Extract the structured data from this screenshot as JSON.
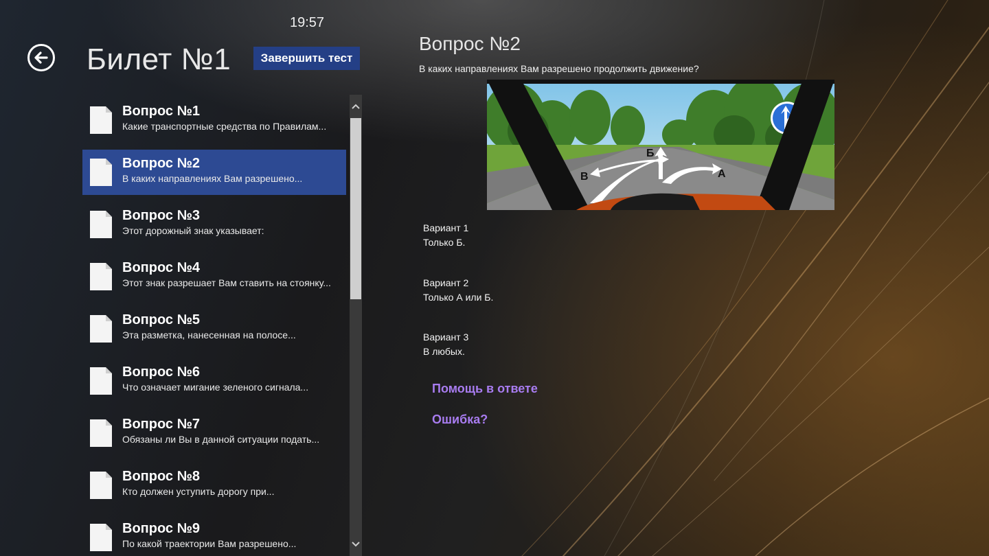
{
  "status": {
    "time": "19:57"
  },
  "header": {
    "title": "Билет №1",
    "finish_label": "Завершить тест"
  },
  "questions": [
    {
      "title": "Вопрос №1",
      "preview": "Какие транспортные средства по Правилам..."
    },
    {
      "title": "Вопрос №2",
      "preview": "В каких направлениях Вам разрешено..."
    },
    {
      "title": "Вопрос №3",
      "preview": "Этот дорожный знак указывает:"
    },
    {
      "title": "Вопрос №4",
      "preview": "Этот знак разрешает Вам ставить на стоянку..."
    },
    {
      "title": "Вопрос №5",
      "preview": "Эта разметка, нанесенная на полосе..."
    },
    {
      "title": "Вопрос №6",
      "preview": "Что означает мигание зеленого сигнала..."
    },
    {
      "title": "Вопрос №7",
      "preview": "Обязаны ли Вы в данной ситуации подать..."
    },
    {
      "title": "Вопрос №8",
      "preview": "Кто должен уступить дорогу при..."
    },
    {
      "title": "Вопрос №9",
      "preview": "По какой траектории Вам разрешено..."
    }
  ],
  "selected_index": 1,
  "detail": {
    "heading": "Вопрос №2",
    "text": "В каких направлениях Вам разрешено продолжить движение?",
    "image_labels": {
      "a": "А",
      "b": "Б",
      "v": "В"
    },
    "variants": [
      {
        "label": "Вариант 1",
        "text": "Только Б."
      },
      {
        "label": "Вариант 2",
        "text": "Только А или Б."
      },
      {
        "label": "Вариант 3",
        "text": "В любых."
      }
    ],
    "help_link": "Помощь в ответе",
    "error_link": "Ошибка?"
  },
  "colors": {
    "accent": "#2d4a93",
    "button": "#243f86",
    "link": "#a87cf0"
  }
}
